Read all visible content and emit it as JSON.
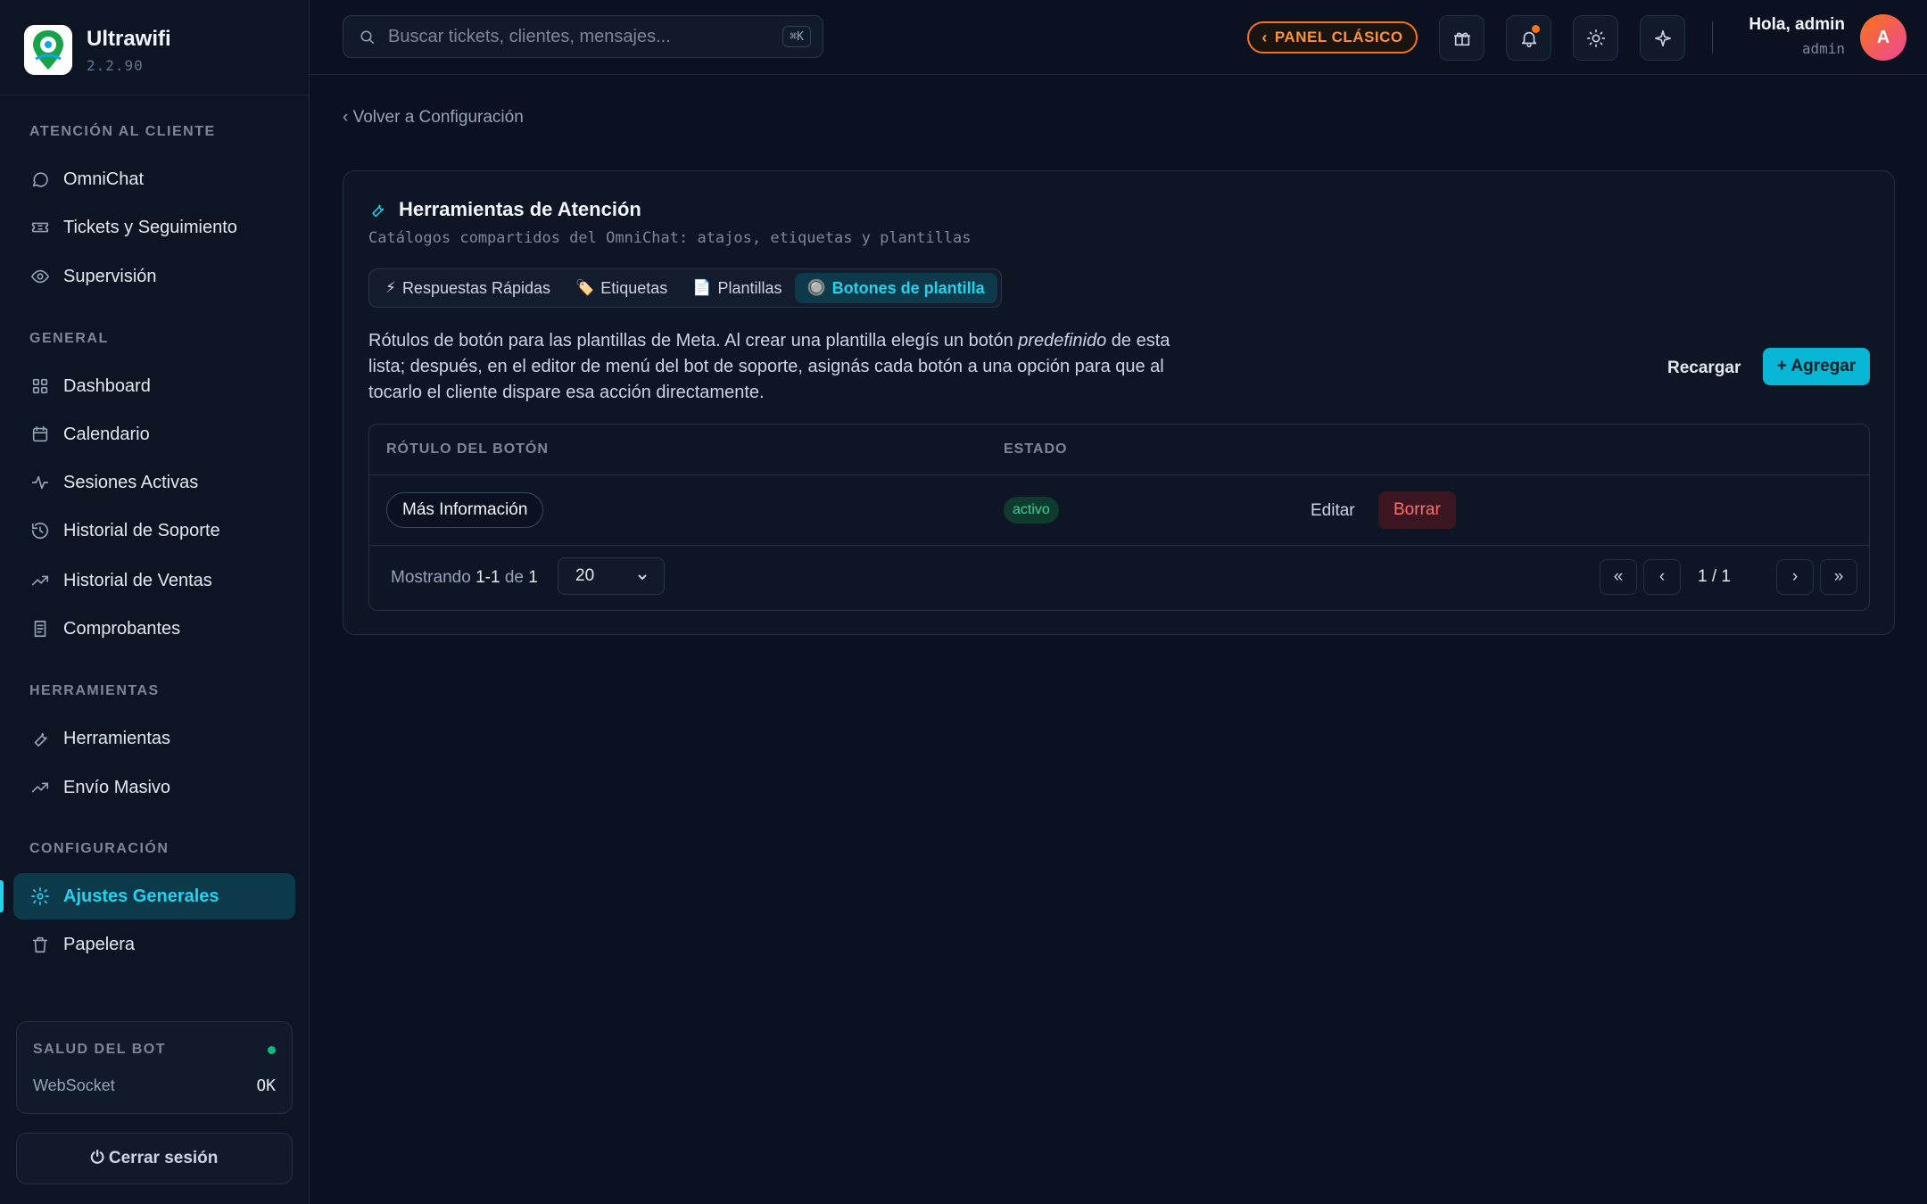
{
  "brand": {
    "name": "Ultrawifi",
    "version": "2.2.90"
  },
  "sidebar": {
    "sections": [
      {
        "title": "ATENCIÓN AL CLIENTE"
      },
      {
        "title": "GENERAL"
      },
      {
        "title": "HERRAMIENTAS"
      },
      {
        "title": "CONFIGURACIÓN"
      }
    ],
    "items": [
      {
        "label": "OmniChat",
        "icon": "chat-icon"
      },
      {
        "label": "Tickets y Seguimiento",
        "icon": "ticket-icon"
      },
      {
        "label": "Supervisión",
        "icon": "eye-icon"
      },
      {
        "label": "Dashboard",
        "icon": "grid-icon"
      },
      {
        "label": "Calendario",
        "icon": "calendar-icon"
      },
      {
        "label": "Sesiones Activas",
        "icon": "activity-icon"
      },
      {
        "label": "Historial de Soporte",
        "icon": "history-icon"
      },
      {
        "label": "Historial de Ventas",
        "icon": "trending-up-icon"
      },
      {
        "label": "Comprobantes",
        "icon": "receipt-icon"
      },
      {
        "label": "Herramientas",
        "icon": "wrench-icon"
      },
      {
        "label": "Envío Masivo",
        "icon": "trending-up-icon"
      },
      {
        "label": "Ajustes Generales",
        "icon": "gear-icon",
        "active": true
      },
      {
        "label": "Papelera",
        "icon": "trash-icon"
      }
    ],
    "health": {
      "title": "SALUD DEL BOT",
      "label": "WebSocket",
      "value": "OK",
      "status_color": "#10b981"
    },
    "logout": "⏻ Cerrar sesión"
  },
  "header": {
    "search_placeholder": "Buscar tickets, clientes, mensajes...",
    "shortcut": "⌘K",
    "classic_panel": "PANEL CLÁSICO",
    "greeting": "Hola, admin",
    "username": "admin",
    "avatar_initial": "A"
  },
  "main": {
    "back_link": "‹ Volver a Configuración",
    "card": {
      "title": "Herramientas de Atención",
      "subtitle": "Catálogos compartidos del OmniChat: atajos, etiquetas y plantillas",
      "tabs": [
        {
          "emoji": "⚡",
          "label": "Respuestas Rápidas"
        },
        {
          "emoji": "🏷️",
          "label": "Etiquetas"
        },
        {
          "emoji": "📄",
          "label": "Plantillas"
        },
        {
          "emoji": "🔘",
          "label": "Botones de plantilla",
          "active": true
        }
      ],
      "description_a": "Rótulos de botón para las plantillas de Meta. Al crear una plantilla elegís un botón ",
      "description_em": "predefinido",
      "description_b": " de esta lista; después, en el editor de menú del bot de soporte, asignás cada botón a una opción para que al tocarlo el cliente dispare esa acción directamente.",
      "reload": "Recargar",
      "add": "+ Agregar"
    },
    "table": {
      "columns": [
        "RÓTULO DEL BOTÓN",
        "ESTADO"
      ],
      "rows": [
        {
          "label": "Más Información",
          "status": "activo",
          "edit": "Editar",
          "delete": "Borrar"
        }
      ],
      "footer": {
        "showing_prefix": "Mostrando",
        "range": "1-1",
        "of": "de",
        "total": "1",
        "per_page": "20",
        "first": "«",
        "prev": "‹",
        "page_info": "1 / 1",
        "next": "›",
        "last": "»"
      }
    }
  },
  "colors": {
    "accent": "#22d3ee",
    "warning": "#f97316",
    "danger": "#f87171",
    "success": "#34d399"
  }
}
